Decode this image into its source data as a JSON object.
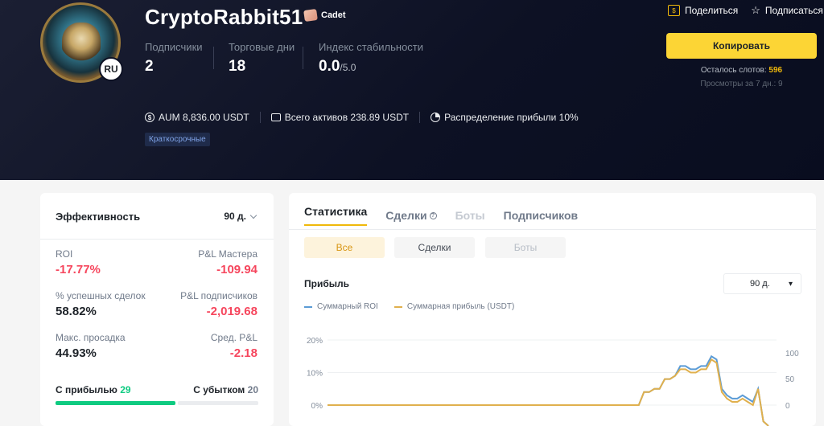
{
  "profile": {
    "username": "CryptoRabbit51",
    "badge": "Cadet",
    "country": "RU",
    "stats": [
      {
        "label": "Подписчики",
        "value": "2",
        "suffix": ""
      },
      {
        "label": "Торговые дни",
        "value": "18",
        "suffix": ""
      },
      {
        "label": "Индекс стабильности",
        "value": "0.0",
        "suffix": "/5.0"
      }
    ],
    "aum": "AUM 8,836.00 USDT",
    "assets": "Всего активов 238.89 USDT",
    "profit_share": "Распределение прибыли 10%",
    "tag": "Краткосрочные"
  },
  "actions": {
    "share": "Поделиться",
    "subscribe": "Подписаться",
    "copy_button": "Копировать",
    "slots_label": "Осталось слотов:",
    "slots_value": "596",
    "views": "Просмотры за 7 дн.: 9"
  },
  "performance": {
    "title": "Эффективность",
    "period": "90 д.",
    "roi_label": "ROI",
    "roi_value": "-17.77%",
    "master_pl_label": "P&L Мастера",
    "master_pl_value": "-109.94",
    "win_rate_label": "% успешных сделок",
    "win_rate_value": "58.82%",
    "sub_pl_label": "P&L подписчиков",
    "sub_pl_value": "-2,019.68",
    "drawdown_label": "Макс. просадка",
    "drawdown_value": "44.93%",
    "avg_pl_label": "Сред. P&L",
    "avg_pl_value": "-2.18",
    "profit_label": "С прибылью",
    "profit_count": "29",
    "loss_label": "С убытком",
    "loss_count": "20",
    "profit_share_fraction": 0.59
  },
  "stats_panel": {
    "tabs": [
      "Статистика",
      "Сделки",
      "Боты",
      "Подписчиков"
    ],
    "segments": [
      "Все",
      "Сделки",
      "Боты"
    ],
    "profit_title": "Прибыль",
    "period": "90 д."
  },
  "chart_data": {
    "type": "line",
    "title": "Прибыль",
    "legend_placement": "top-left",
    "series": [
      {
        "name": "Суммарный ROI",
        "color": "#5b9bd5",
        "axis": "left"
      },
      {
        "name": "Суммарная прибыль (USDT)",
        "color": "#e0b04d",
        "axis": "right"
      }
    ],
    "left_ticks": [
      "20%",
      "10%",
      "0%"
    ],
    "right_ticks": [
      "100",
      "50",
      "0"
    ],
    "roi_values": [
      0,
      0,
      0,
      0,
      0,
      0,
      0,
      0,
      0,
      0,
      0,
      0,
      0,
      0,
      0,
      0,
      0,
      0,
      0,
      0,
      0,
      0,
      0,
      0,
      0,
      0,
      0,
      0,
      0,
      0,
      0,
      0,
      0,
      0,
      0,
      0,
      0,
      0,
      0,
      0,
      0,
      0,
      0,
      0,
      0,
      0,
      0,
      0,
      0,
      0,
      0,
      0,
      0,
      0,
      0,
      0,
      0,
      0,
      0,
      0,
      0,
      4,
      4,
      5,
      5,
      8,
      8,
      9,
      12,
      12,
      11,
      11,
      12,
      12,
      15,
      14,
      5,
      3,
      2,
      2,
      3,
      2,
      1,
      5,
      -5,
      -15
    ],
    "profit_values": [
      0,
      0,
      0,
      0,
      0,
      0,
      0,
      0,
      0,
      0,
      0,
      0,
      0,
      0,
      0,
      0,
      0,
      0,
      0,
      0,
      0,
      0,
      0,
      0,
      0,
      0,
      0,
      0,
      0,
      0,
      0,
      0,
      0,
      0,
      0,
      0,
      0,
      0,
      0,
      0,
      0,
      0,
      0,
      0,
      0,
      0,
      0,
      0,
      0,
      0,
      0,
      0,
      0,
      0,
      0,
      0,
      0,
      0,
      0,
      0,
      0,
      4,
      4,
      5,
      5,
      8,
      8,
      9,
      11,
      11,
      10,
      10,
      11,
      11,
      14,
      13,
      4,
      2,
      1,
      1,
      2,
      1,
      0,
      5,
      -5,
      -15
    ],
    "ylim": [
      -2,
      22
    ],
    "grid": true
  }
}
